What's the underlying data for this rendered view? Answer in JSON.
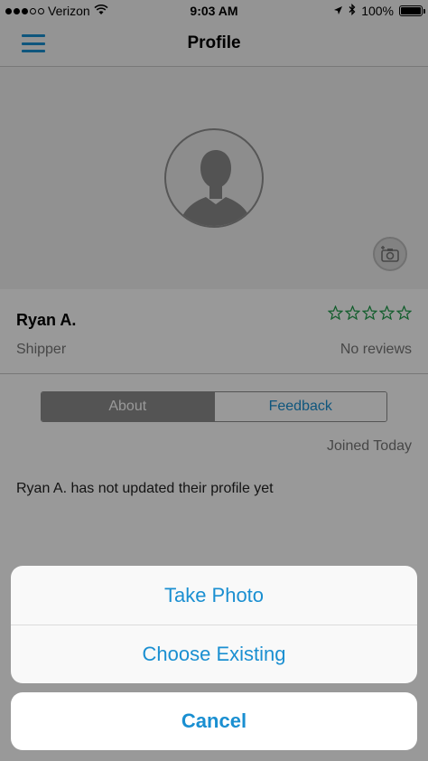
{
  "status_bar": {
    "carrier": "Verizon",
    "time": "9:03 AM",
    "battery": "100%"
  },
  "nav": {
    "title": "Profile"
  },
  "profile": {
    "name": "Ryan A.",
    "role": "Shipper",
    "rating_stars_filled": 0,
    "rating_stars_total": 5,
    "reviews": "No reviews",
    "joined": "Joined Today",
    "bio": "Ryan A. has not updated their profile yet"
  },
  "tabs": [
    {
      "label": "About",
      "selected": true
    },
    {
      "label": "Feedback",
      "selected": false
    }
  ],
  "action_sheet": {
    "take_photo": "Take Photo",
    "choose_existing": "Choose Existing",
    "cancel": "Cancel"
  },
  "colors": {
    "accent": "#1a8fd1",
    "star": "#1e9c4a"
  }
}
